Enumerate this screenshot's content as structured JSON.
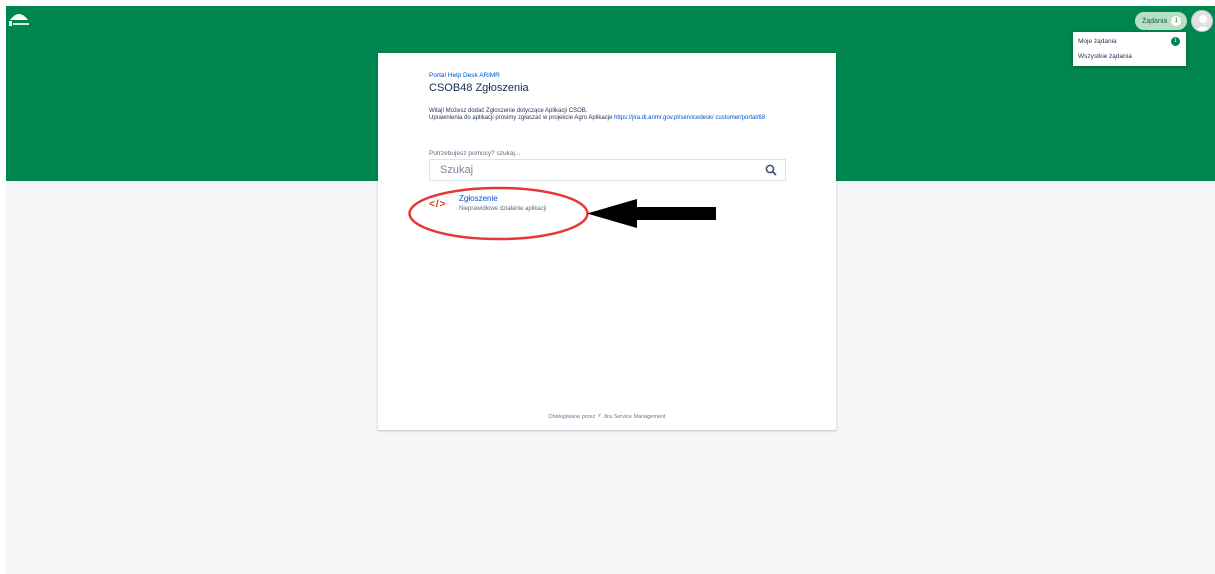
{
  "header": {
    "requests_label": "Żądania",
    "requests_count": "1"
  },
  "requests_menu": {
    "items": [
      {
        "label": "Moje żądania",
        "count": "1"
      },
      {
        "label": "Wszystkie żądania"
      }
    ]
  },
  "portal": {
    "breadcrumb": "Portal Help Desk ARiMR",
    "title": "CSOB48 Zgłoszenia",
    "welcome_line1": "Witaj! Możesz dodać Zgłoszenie dotyczące Aplikacji CSOB.",
    "welcome_line2": "Uprawnienia do aplikacji prosimy zgłaszać w projekcie Agro Aplikacje",
    "welcome_link": "https://jira.di.arimr.gov.pl/servicedesk/ customer/portal/68",
    "help_label": "Potrzebujesz pomocy? szukaj...",
    "search_placeholder": "Szukaj",
    "request_types": [
      {
        "icon": "code-icon",
        "glyph": "</>",
        "name": "Zgłoszenie",
        "description": "Nieprawidłowe działanie aplikacji"
      }
    ],
    "footer_prefix": "Obsługiwane przez",
    "footer_product": "Jira Service Management"
  },
  "colors": {
    "header": "#00854e",
    "background": "#f4f5f7",
    "annotation": "#e53935",
    "link": "#0052cc"
  }
}
